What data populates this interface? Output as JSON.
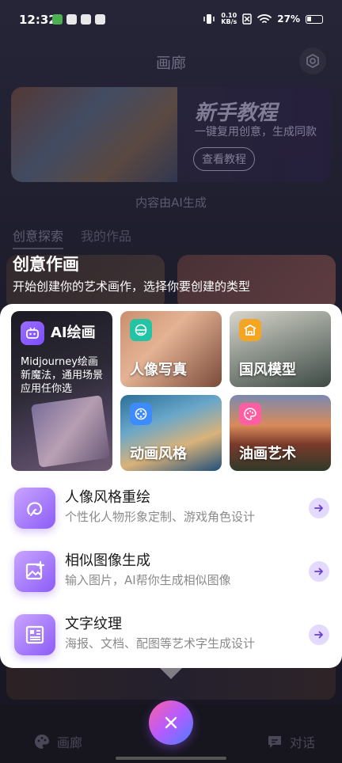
{
  "status": {
    "time": "12:32",
    "net_speed": "0.10",
    "net_unit": "KB/s",
    "battery": "27%"
  },
  "header": {
    "title": "画廊",
    "settings_icon": "hexagon-settings-icon"
  },
  "banner": {
    "title": "新手教程",
    "subtitle": "一键复用创意，生成同款",
    "button": "查看教程"
  },
  "ai_note": "内容由AI生成",
  "tabs": [
    {
      "label": "创意探索",
      "active": true
    },
    {
      "label": "我的作品",
      "active": false
    }
  ],
  "overlay": {
    "title": "创意作画",
    "subtitle": "开始创建你的艺术画作，选择你要创建的类型"
  },
  "ai_card": {
    "label": "AI绘画",
    "description": "Midjourney绘画新魔法，通用场景应用任你选",
    "icon": "robot-icon"
  },
  "tiles": [
    {
      "label": "人像写真",
      "icon": "face-icon",
      "icon_color": "#22c4a4"
    },
    {
      "label": "国风模型",
      "icon": "pavilion-icon",
      "icon_color": "#f5a524"
    },
    {
      "label": "动画风格",
      "icon": "film-reel-icon",
      "icon_color": "#3d8bff"
    },
    {
      "label": "油画艺术",
      "icon": "palette-icon",
      "icon_color": "#ff5fa2"
    }
  ],
  "rows": [
    {
      "title": "人像风格重绘",
      "subtitle": "个性化人物形象定制、游戏角色设计",
      "icon": "portrait-redraw-icon"
    },
    {
      "title": "相似图像生成",
      "subtitle": "输入图片，AI帮你生成相似图像",
      "icon": "image-add-icon"
    },
    {
      "title": "文字纹理",
      "subtitle": "海报、文档、配图等艺术字生成设计",
      "icon": "text-texture-icon"
    }
  ],
  "bottom_nav": {
    "gallery": "画廊",
    "chat": "对话"
  },
  "colors": {
    "accent": "#8b5cf6",
    "fab_start": "#ff5fa2",
    "fab_end": "#4a7dff"
  }
}
